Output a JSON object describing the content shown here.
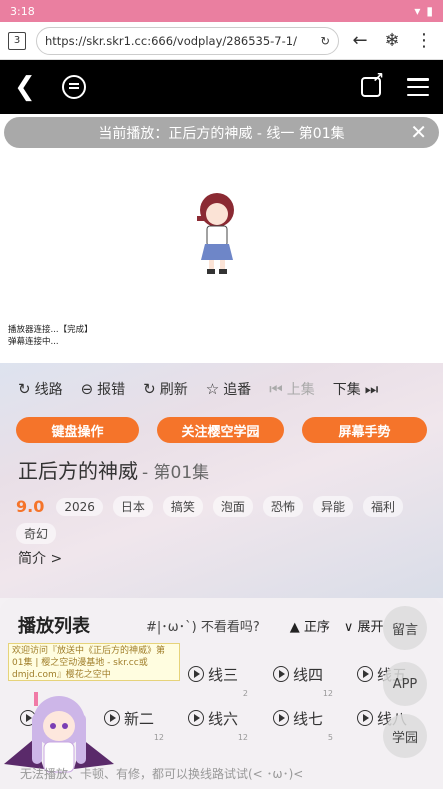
{
  "status": {
    "time": "3:18"
  },
  "browser": {
    "tab_count": "3",
    "url": "https://skr.skr1.cc:666/vodplay/286535-7-1/"
  },
  "now_playing": "当前播放：正后方的神威 - 线一 第01集",
  "player_log": {
    "line1": "播放器连接...【完成】",
    "line2": "弹幕连接中..."
  },
  "actions": [
    {
      "label": "线路",
      "icon": "refresh-icon"
    },
    {
      "label": "报错",
      "icon": "minus-circle-icon"
    },
    {
      "label": "刷新",
      "icon": "refresh-icon"
    },
    {
      "label": "追番",
      "icon": "star-icon"
    },
    {
      "label": "上集",
      "icon": "prev-icon"
    },
    {
      "label": "下集",
      "icon": "next-icon"
    }
  ],
  "pills": [
    "键盘操作",
    "关注樱空学园",
    "屏幕手势"
  ],
  "show": {
    "title": "正后方的神威",
    "episode": "- 第01集",
    "score": "9.0",
    "tags": [
      "2026",
      "日本",
      "搞笑",
      "泡面",
      "恐怖",
      "异能",
      "福利",
      "奇幻"
    ],
    "intro": "简介 >"
  },
  "playlist": {
    "title": "播放列表",
    "subtitle": "#|･ω･`) 不看看吗?",
    "sort": "▲ 正序",
    "expand": "∨ 展开",
    "lines": [
      {
        "label": "线三",
        "count": "2"
      },
      {
        "label": "线四",
        "count": "12"
      },
      {
        "label": "线五",
        "count": ""
      },
      {
        "label": "新二",
        "count": "12"
      },
      {
        "label": "线六",
        "count": "12"
      },
      {
        "label": "线七",
        "count": "5"
      },
      {
        "label": "线八",
        "count": ""
      }
    ],
    "left_counts": [
      "12",
      "12",
      "12",
      "12"
    ]
  },
  "float_buttons": [
    "留言",
    "APP",
    "学园"
  ],
  "welcome": "欢迎访问『放送中《正后方的神威》第01集 | 樱之空动漫基地 - skr.cc或dmjd.com』樱花之空中",
  "bottom_note": "无法播放、卡顿、有修，都可以换线路试试(< ･ω･)<"
}
